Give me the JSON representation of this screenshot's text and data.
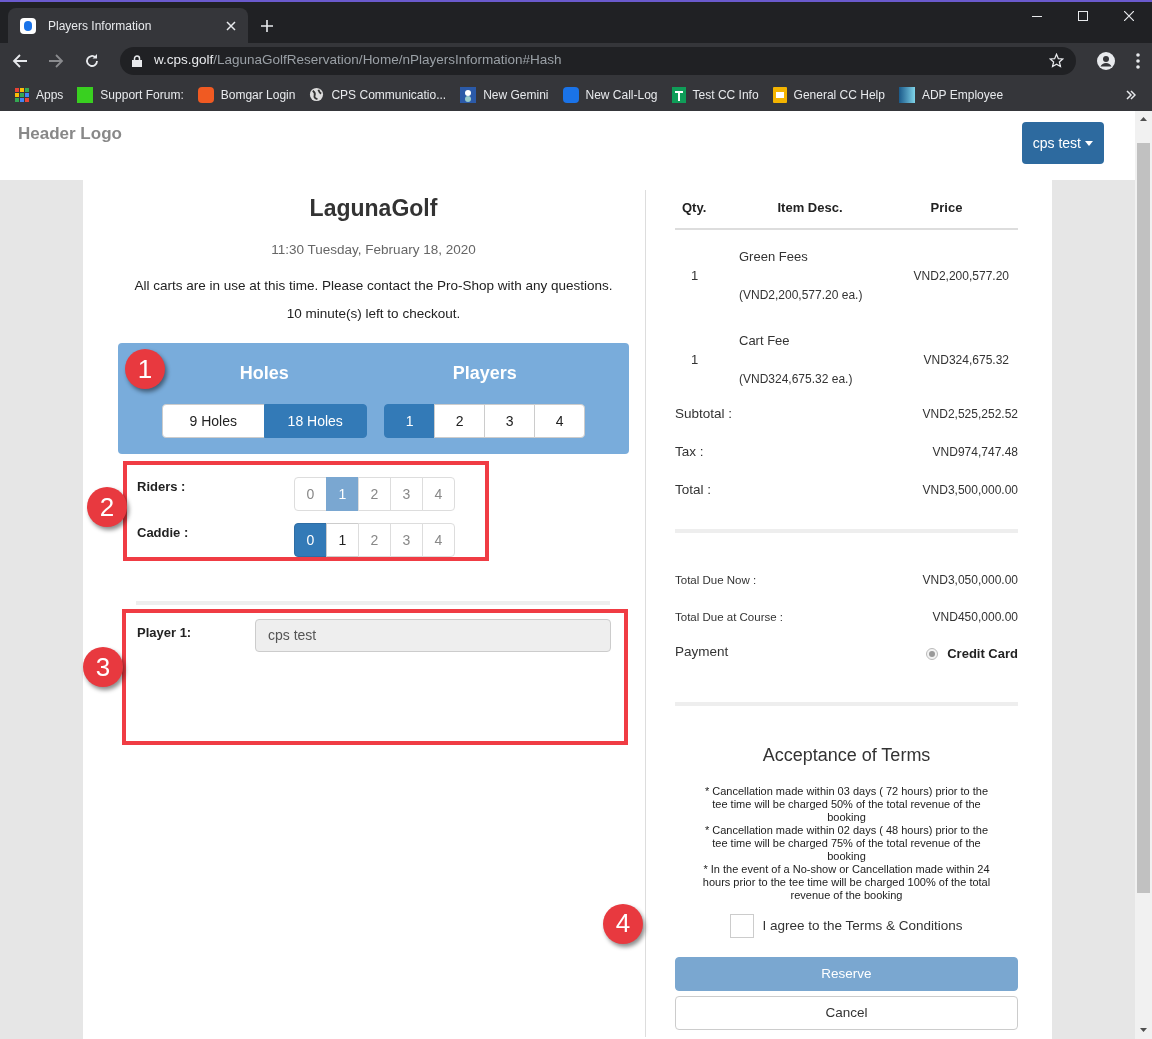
{
  "browser": {
    "tab_title": "Players Information",
    "url_host": "w.cps.golf",
    "url_path": "/LagunaGolfReservation/Home/nPlayersInformation#Hash",
    "bookmarks": [
      {
        "label": "Apps",
        "kind": "apps"
      },
      {
        "label": "Support Forum:",
        "kind": "kb"
      },
      {
        "label": "Bomgar Login",
        "kind": "bomgar"
      },
      {
        "label": "CPS Communicatio...",
        "kind": "globe"
      },
      {
        "label": "New Gemini",
        "kind": "gemini"
      },
      {
        "label": "New Call-Log",
        "kind": "calllog"
      },
      {
        "label": "Test CC Info",
        "kind": "sheet"
      },
      {
        "label": "General CC Help",
        "kind": "slides"
      },
      {
        "label": "ADP Employee",
        "kind": "adp"
      }
    ]
  },
  "header": {
    "logo_alt": "Header Logo",
    "user_menu": "cps test"
  },
  "booking": {
    "title": "LagunaGolf",
    "datetime": "11:30 Tuesday, February 18, 2020",
    "notice": "All carts are in use at this time. Please contact the Pro-Shop with any questions.",
    "timer": "10 minute(s) left to checkout."
  },
  "selection": {
    "badge": "1",
    "groups": [
      {
        "label": "Holes",
        "options": [
          {
            "label": "9 Holes",
            "selected": false
          },
          {
            "label": "18 Holes",
            "selected": true
          }
        ]
      },
      {
        "label": "Players",
        "options": [
          {
            "label": "1",
            "selected": true
          },
          {
            "label": "2",
            "selected": false
          },
          {
            "label": "3",
            "selected": false
          },
          {
            "label": "4",
            "selected": false
          }
        ]
      }
    ]
  },
  "extras": {
    "badge": "2",
    "groups": [
      {
        "label": "Riders :",
        "options": [
          {
            "label": "0",
            "selected": false,
            "disabled": true
          },
          {
            "label": "1",
            "selected": true,
            "disabled": true
          },
          {
            "label": "2",
            "selected": false,
            "disabled": true
          },
          {
            "label": "3",
            "selected": false,
            "disabled": true
          },
          {
            "label": "4",
            "selected": false,
            "disabled": true
          }
        ]
      },
      {
        "label": "Caddie :",
        "options": [
          {
            "label": "0",
            "selected": true,
            "disabled": false
          },
          {
            "label": "1",
            "selected": false,
            "disabled": false
          },
          {
            "label": "2",
            "selected": false,
            "disabled": true
          },
          {
            "label": "3",
            "selected": false,
            "disabled": true
          },
          {
            "label": "4",
            "selected": false,
            "disabled": true
          }
        ]
      }
    ]
  },
  "players": {
    "badge": "3",
    "items": [
      {
        "label": "Player 1:",
        "value": "cps test"
      }
    ]
  },
  "order": {
    "columns": [
      "Qty.",
      "Item Desc.",
      "Price"
    ],
    "rows": [
      {
        "qty": "1",
        "item": "Green Fees",
        "unit_price": "(VND2,200,577.20 ea.)",
        "price": "VND2,200,577.20"
      },
      {
        "qty": "1",
        "item": "Cart Fee",
        "unit_price": "(VND324,675.32 ea.)",
        "price": "VND324,675.32"
      }
    ],
    "summary": [
      {
        "label": "Subtotal :",
        "value": "VND2,525,252.52"
      },
      {
        "label": "Tax :",
        "value": "VND974,747.48"
      },
      {
        "label": "Total :",
        "value": "VND3,500,000.00"
      }
    ],
    "due": [
      {
        "label": "Total Due Now :",
        "value": "VND3,050,000.00"
      },
      {
        "label": "Total Due at Course :",
        "value": "VND450,000.00"
      }
    ],
    "payment": {
      "label": "Payment",
      "options": [
        {
          "label": "Credit Card",
          "selected": true
        }
      ]
    }
  },
  "terms": {
    "title": "Acceptance of Terms",
    "clauses": [
      "* Cancellation made within 03 days ( 72 hours) prior to the tee time will be charged 50% of the total revenue of the booking",
      "* Cancellation made within 02 days ( 48 hours) prior to the tee time will be charged 75% of the total revenue of the booking",
      "* In the event of a No-show or Cancellation made within 24 hours prior to the tee time will be charged 100% of the total revenue of the booking"
    ],
    "badge": "4",
    "agree": {
      "label": "I agree to the Terms & Conditions",
      "checked": false
    }
  },
  "buttons": [
    {
      "label": "Reserve",
      "kind": "primary",
      "disabled": true
    },
    {
      "label": "Cancel",
      "kind": "default",
      "disabled": false
    }
  ]
}
